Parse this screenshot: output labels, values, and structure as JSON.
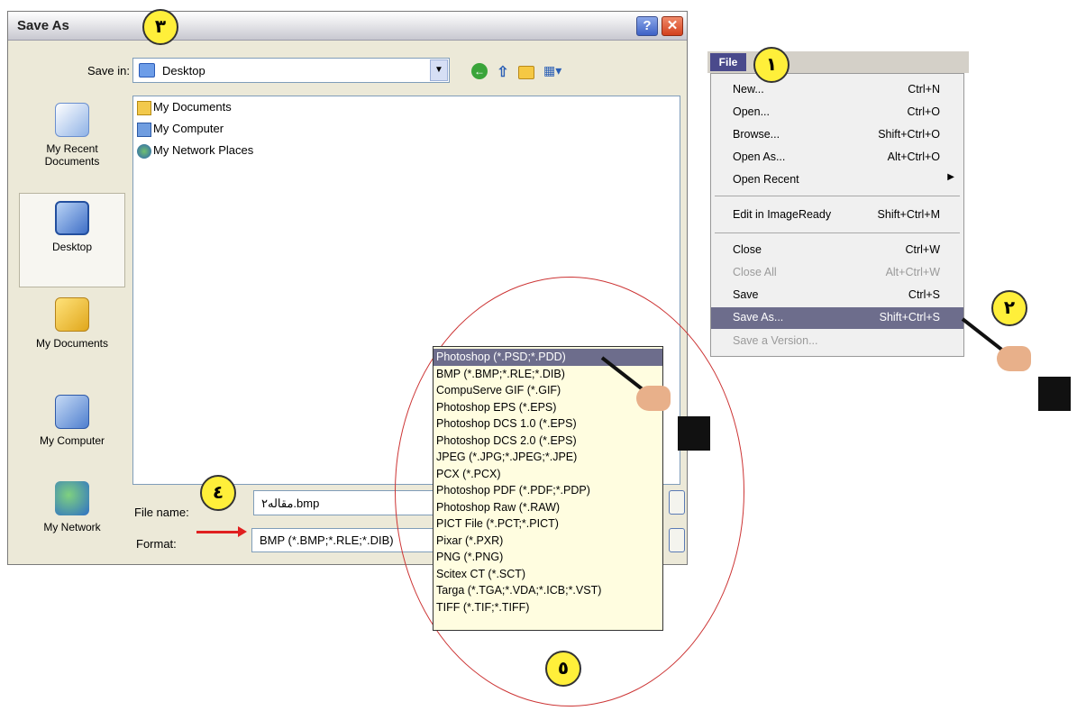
{
  "dialog": {
    "title": "Save As",
    "help_btn": "?",
    "close_btn": "✕",
    "save_in_label": "Save in:",
    "save_in_value": "Desktop",
    "places": [
      {
        "label": "My Recent Documents"
      },
      {
        "label": "Desktop"
      },
      {
        "label": "My Documents"
      },
      {
        "label": "My Computer"
      },
      {
        "label": "My Network"
      }
    ],
    "files": [
      "My Documents",
      "My Computer",
      "My Network Places"
    ],
    "file_name_label": "File name:",
    "file_name_value": "مقاله۲.bmp",
    "format_label": "Format:",
    "format_value": "BMP (*.BMP;*.RLE;*.DIB)"
  },
  "format_options": [
    "Photoshop (*.PSD;*.PDD)",
    "BMP (*.BMP;*.RLE;*.DIB)",
    "CompuServe GIF (*.GIF)",
    "Photoshop EPS (*.EPS)",
    "Photoshop DCS 1.0 (*.EPS)",
    "Photoshop DCS 2.0 (*.EPS)",
    "JPEG (*.JPG;*.JPEG;*.JPE)",
    "PCX (*.PCX)",
    "Photoshop PDF (*.PDF;*.PDP)",
    "Photoshop Raw (*.RAW)",
    "PICT File (*.PCT;*.PICT)",
    "Pixar (*.PXR)",
    "PNG (*.PNG)",
    "Scitex CT (*.SCT)",
    "Targa (*.TGA;*.VDA;*.ICB;*.VST)",
    "TIFF (*.TIF;*.TIFF)"
  ],
  "file_menu": {
    "title": "File",
    "items": [
      {
        "label": "New...",
        "shortcut": "Ctrl+N"
      },
      {
        "label": "Open...",
        "shortcut": "Ctrl+O"
      },
      {
        "label": "Browse...",
        "shortcut": "Shift+Ctrl+O"
      },
      {
        "label": "Open As...",
        "shortcut": "Alt+Ctrl+O"
      },
      {
        "label": "Open Recent",
        "shortcut": "▶"
      },
      {
        "label": "Edit in ImageReady",
        "shortcut": "Shift+Ctrl+M"
      },
      {
        "label": "Close",
        "shortcut": "Ctrl+W"
      },
      {
        "label": "Close All",
        "shortcut": "Alt+Ctrl+W"
      },
      {
        "label": "Save",
        "shortcut": "Ctrl+S"
      },
      {
        "label": "Save As...",
        "shortcut": "Shift+Ctrl+S"
      },
      {
        "label": "Save a Version...",
        "shortcut": ""
      }
    ]
  },
  "badges": [
    "١",
    "٢",
    "٣",
    "٤",
    "٥"
  ],
  "colors": {
    "badge": "#ffef3a",
    "menu_highlight": "#6d6d8c",
    "dropdown_bg": "#fffde0",
    "ellipse": "#cc3333",
    "arrow": "#e02020"
  }
}
